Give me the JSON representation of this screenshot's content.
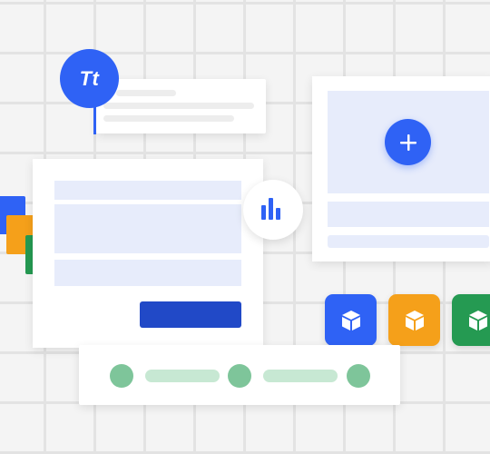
{
  "text_badge": {
    "label": "Tt",
    "color": "#2f62f5"
  },
  "icons": {
    "text": "text-style-icon",
    "chart": "bar-chart-icon",
    "add": "plus-icon",
    "component": "cube-icon"
  },
  "colors": {
    "blue": "#2f62f5",
    "dark_blue": "#2149c7",
    "orange": "#f5a01a",
    "green": "#259a52",
    "light_blue": "#e7ecfb",
    "light_green": "#c7e8d3",
    "mid_green": "#7ec59a",
    "grid": "#e3e3e3",
    "background": "#f4f4f4"
  },
  "component_tiles": [
    "blue",
    "orange",
    "green"
  ],
  "stepper": {
    "steps": 3
  }
}
